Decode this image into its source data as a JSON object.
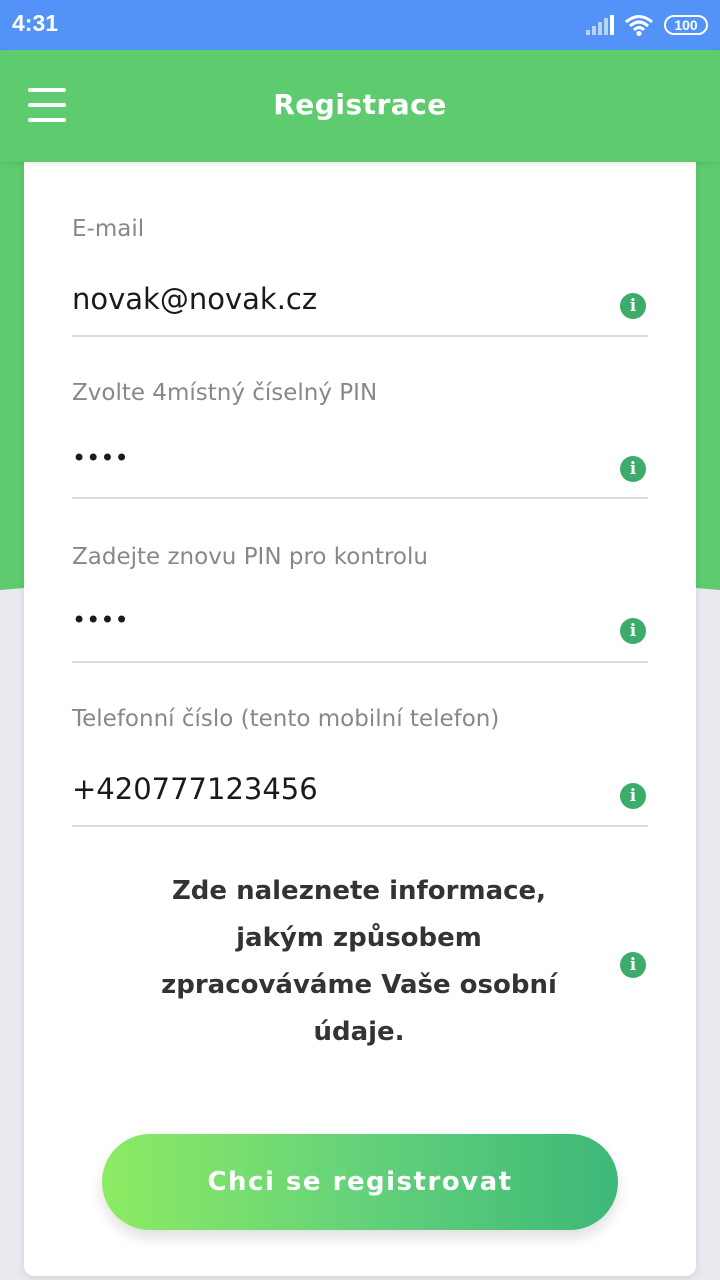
{
  "status_bar": {
    "time": "4:31",
    "battery": "100",
    "icons": [
      "signal-icon",
      "wifi-icon",
      "battery-icon"
    ]
  },
  "app_bar": {
    "title": "Registrace",
    "menu_icon": "hamburger-menu-icon"
  },
  "form": {
    "email": {
      "label": "E-mail",
      "value": "novak@novak.cz"
    },
    "pin": {
      "label": "Zvolte 4místný číselný PIN",
      "value": "••••"
    },
    "pin_confirm": {
      "label": "Zadejte znovu PIN pro kontrolu",
      "value": "••••"
    },
    "phone": {
      "label": "Telefonní číslo (tento mobilní telefon)",
      "value": "+420777123456"
    },
    "info_icon": "i"
  },
  "privacy_text": "Zde naleznete informace, jakým způsobem zpracováváme Vaše osobní údaje.",
  "register_button": "Chci se registrovat",
  "colors": {
    "status_bar": "#5392f6",
    "app_bar": "#5fcb6f",
    "info_icon": "#3dac6a",
    "button_gradient_start": "#8deb63",
    "button_gradient_end": "#3db878"
  }
}
